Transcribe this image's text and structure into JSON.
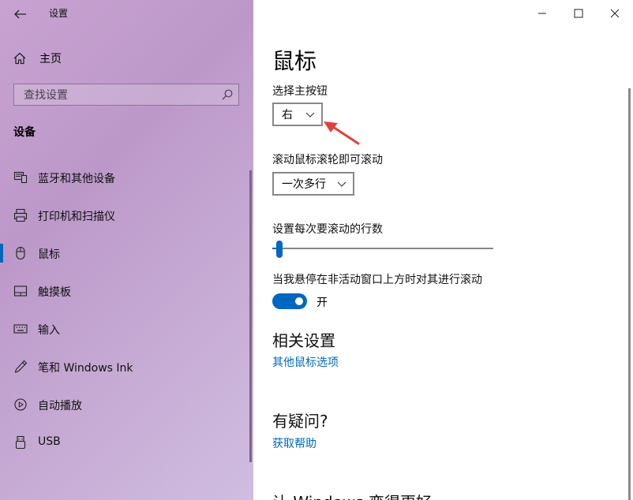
{
  "app": {
    "title": "设置"
  },
  "sidebar": {
    "home_label": "主页",
    "search_placeholder": "查找设置",
    "section_title": "设备",
    "items": [
      {
        "label": "蓝牙和其他设备",
        "icon": "bluetooth-devices-icon"
      },
      {
        "label": "打印机和扫描仪",
        "icon": "printer-icon"
      },
      {
        "label": "鼠标",
        "icon": "mouse-icon",
        "selected": true
      },
      {
        "label": "触摸板",
        "icon": "touchpad-icon"
      },
      {
        "label": "输入",
        "icon": "keyboard-icon"
      },
      {
        "label": "笔和 Windows Ink",
        "icon": "pen-icon"
      },
      {
        "label": "自动播放",
        "icon": "autoplay-icon"
      },
      {
        "label": "USB",
        "icon": "usb-icon"
      }
    ]
  },
  "main": {
    "page_title": "鼠标",
    "primary_button": {
      "label": "选择主按钮",
      "value": "右"
    },
    "scroll_mode": {
      "label": "滚动鼠标滚轮即可滚动",
      "value": "一次多行"
    },
    "scroll_lines": {
      "label": "设置每次要滚动的行数",
      "value": 3,
      "min": 1,
      "max": 100
    },
    "inactive_scroll": {
      "label": "当我悬停在非活动窗口上方时对其进行滚动",
      "state": "开",
      "on": true
    },
    "related": {
      "title": "相关设置",
      "link": "其他鼠标选项"
    },
    "questions": {
      "title": "有疑问?",
      "link": "获取帮助"
    },
    "feedback": {
      "title": "让 Windows 变得更好"
    }
  },
  "colors": {
    "accent": "#0067c0",
    "annotation_arrow": "#e0423a"
  }
}
